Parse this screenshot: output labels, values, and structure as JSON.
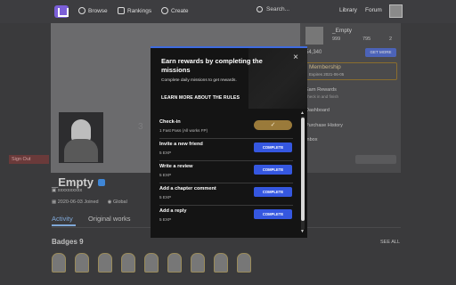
{
  "nav": {
    "browse": "Browse",
    "rankings": "Rankings",
    "create": "Create",
    "search_placeholder": "Search...",
    "library": "Library",
    "forum": "Forum"
  },
  "profile": {
    "name": "_Empty",
    "id": "xxxxxxxxxx",
    "joined": "2020-06-03 Joined",
    "location": "Global",
    "number": "3",
    "tabs": [
      "Activity",
      "Original works"
    ],
    "badges_title": "Badges 9",
    "see_all": "SEE ALL",
    "badge_count": 9
  },
  "dropdown": {
    "name": "_Empty",
    "stat1": "999",
    "stat2": "795",
    "stat3": "2",
    "coins": "54,340",
    "get_more": "GET MORE",
    "membership": "Membership",
    "membership_sub": "Expires 2021-06-05",
    "earn_rewards": "Earn Rewards",
    "earn_sub": "check in and finish",
    "dashboard": "Dashboard",
    "purchase_history": "Purchase History",
    "inbox": "Inbox",
    "sign_out": "Sign Out"
  },
  "modal": {
    "title": "Earn rewards by completing the missions",
    "subtitle": "Complete daily missions to get rewards.",
    "learn_more": "LEARN MORE ABOUT THE RULES",
    "close": "×",
    "tasks": [
      {
        "title": "Check-in",
        "reward": "1 Fast Pass (All works FP)",
        "action": "✓",
        "done": true
      },
      {
        "title": "Invite a new friend",
        "reward": "5 EXP",
        "action": "COMPLETE",
        "done": false
      },
      {
        "title": "Write a review",
        "reward": "5 EXP",
        "action": "COMPLETE",
        "done": false
      },
      {
        "title": "Add a chapter comment",
        "reward": "5 EXP",
        "action": "COMPLETE",
        "done": false
      },
      {
        "title": "Add a reply",
        "reward": "5 EXP",
        "action": "COMPLETE",
        "done": false
      }
    ]
  },
  "colors": {
    "accent": "#3557e0",
    "checkin": "#9a7a3a",
    "modal_bg": "#141414"
  }
}
